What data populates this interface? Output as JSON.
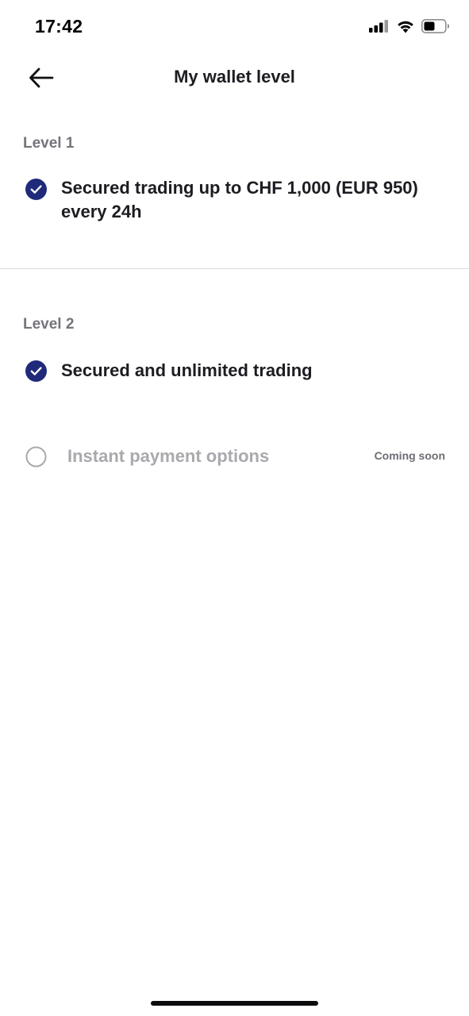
{
  "status_bar": {
    "time": "17:42"
  },
  "header": {
    "title": "My wallet level",
    "back_icon": "arrow-left-icon"
  },
  "levels": [
    {
      "label": "Level 1",
      "features": [
        {
          "text": "Secured trading up to CHF 1,000 (EUR 950) every 24h",
          "state": "checked"
        }
      ]
    },
    {
      "label": "Level 2",
      "features": [
        {
          "text": "Secured and unlimited trading",
          "state": "checked"
        },
        {
          "text": "Instant payment options",
          "state": "pending",
          "badge": "Coming soon"
        }
      ]
    }
  ],
  "colors": {
    "accent": "#1f2a7a",
    "text_primary": "#1c1c22",
    "text_secondary": "#74747c",
    "text_disabled": "#a9a9ae"
  }
}
